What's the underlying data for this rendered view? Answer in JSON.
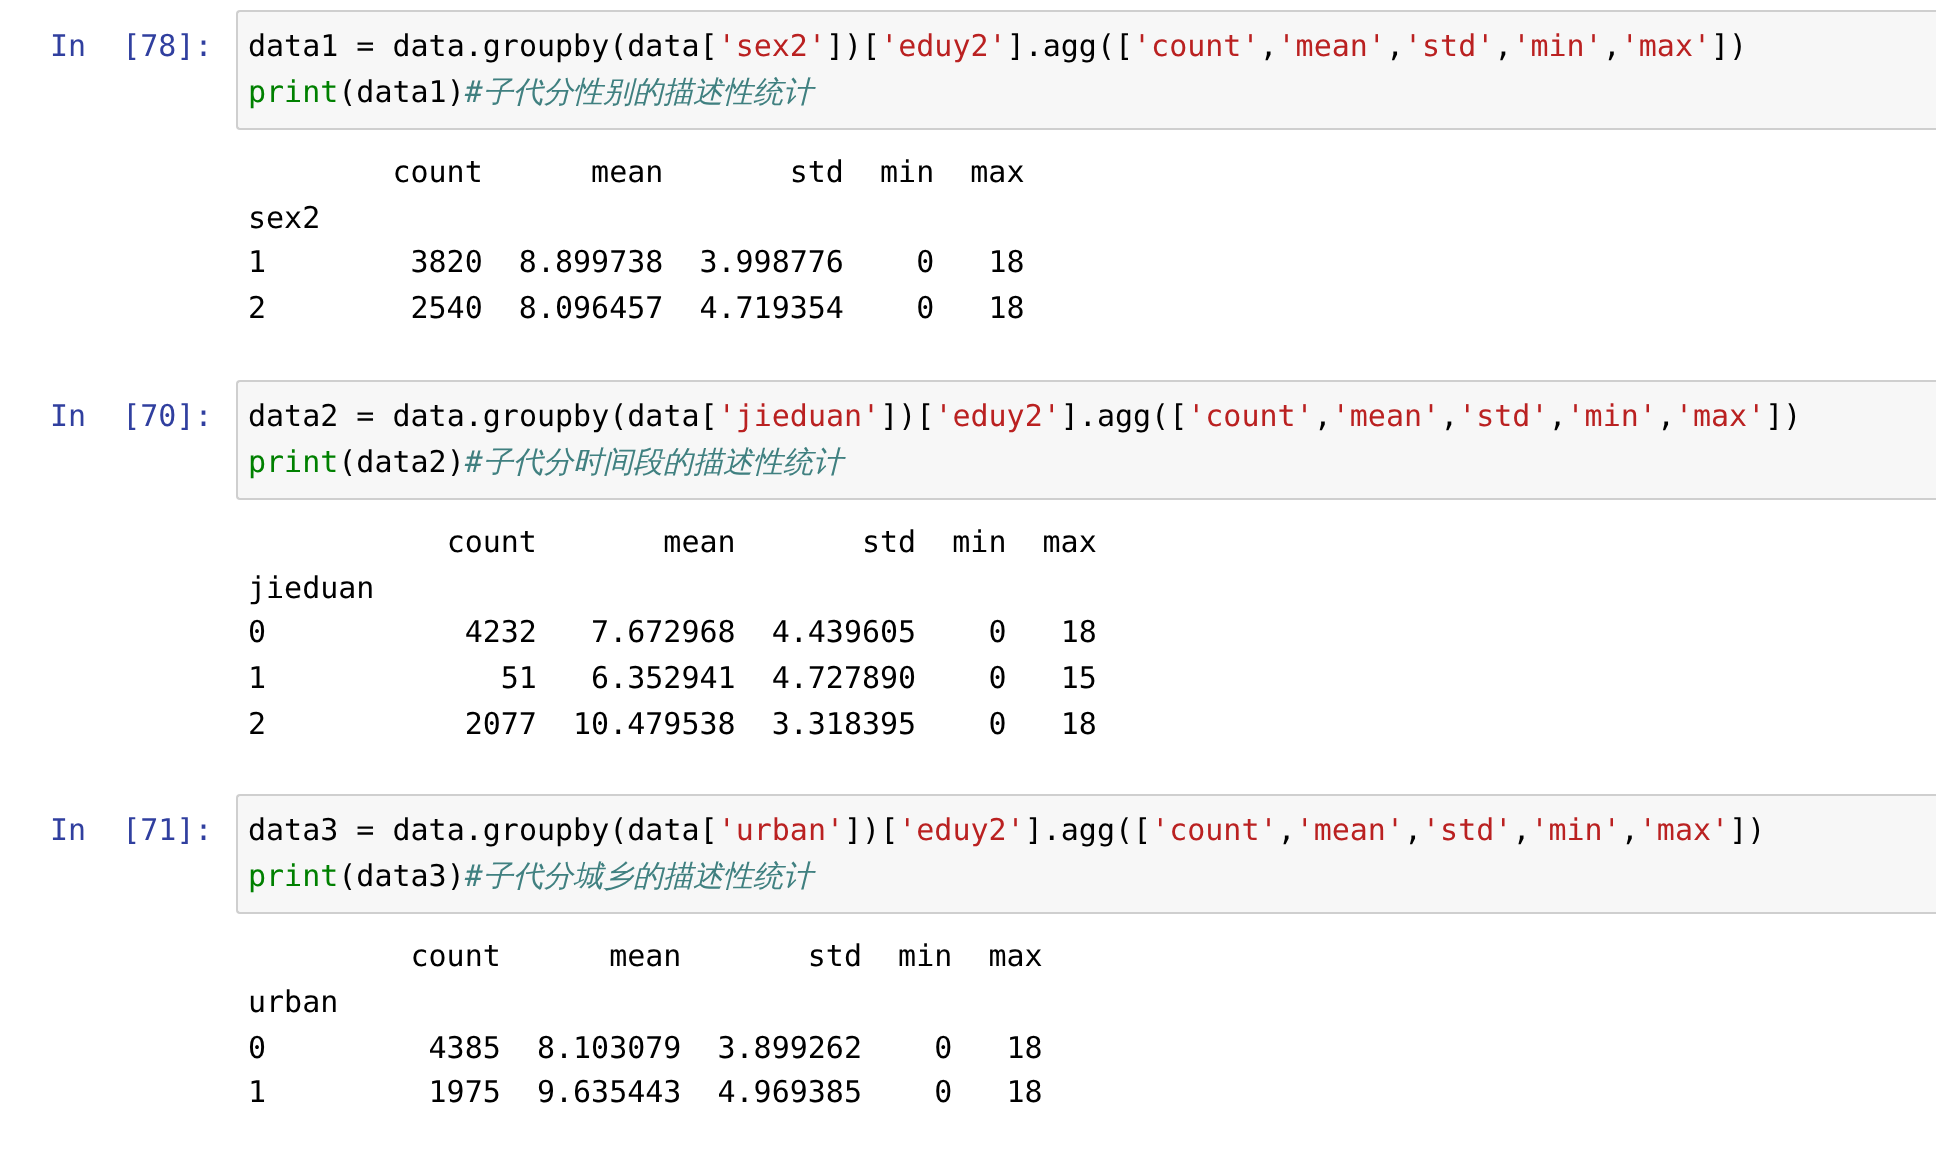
{
  "cells": [
    {
      "prompt": "In  [78]:",
      "code": [
        [
          {
            "kind": "plain",
            "text": "data1 = data.groupby(data["
          },
          {
            "kind": "string",
            "text": "'sex2'"
          },
          {
            "kind": "plain",
            "text": "])["
          },
          {
            "kind": "string",
            "text": "'eduy2'"
          },
          {
            "kind": "plain",
            "text": "].agg(["
          },
          {
            "kind": "string",
            "text": "'count'"
          },
          {
            "kind": "plain",
            "text": ","
          },
          {
            "kind": "string",
            "text": "'mean'"
          },
          {
            "kind": "plain",
            "text": ","
          },
          {
            "kind": "string",
            "text": "'std'"
          },
          {
            "kind": "plain",
            "text": ","
          },
          {
            "kind": "string",
            "text": "'min'"
          },
          {
            "kind": "plain",
            "text": ","
          },
          {
            "kind": "string",
            "text": "'max'"
          },
          {
            "kind": "plain",
            "text": "])"
          }
        ],
        [
          {
            "kind": "builtin",
            "text": "print"
          },
          {
            "kind": "plain",
            "text": "(data1)"
          },
          {
            "kind": "comment",
            "text": "#子代分性别的描述性统计"
          }
        ]
      ],
      "output": {
        "columns": [
          "count",
          "mean",
          "std",
          "min",
          "max"
        ],
        "index_name": "sex2",
        "rows": [
          {
            "index": "1",
            "values": [
              "3820",
              "8.899738",
              "3.998776",
              "0",
              "18"
            ]
          },
          {
            "index": "2",
            "values": [
              "2540",
              "8.096457",
              "4.719354",
              "0",
              "18"
            ]
          }
        ]
      }
    },
    {
      "prompt": "In  [70]:",
      "code": [
        [
          {
            "kind": "plain",
            "text": "data2 = data.groupby(data["
          },
          {
            "kind": "string",
            "text": "'jieduan'"
          },
          {
            "kind": "plain",
            "text": "])["
          },
          {
            "kind": "string",
            "text": "'eduy2'"
          },
          {
            "kind": "plain",
            "text": "].agg(["
          },
          {
            "kind": "string",
            "text": "'count'"
          },
          {
            "kind": "plain",
            "text": ","
          },
          {
            "kind": "string",
            "text": "'mean'"
          },
          {
            "kind": "plain",
            "text": ","
          },
          {
            "kind": "string",
            "text": "'std'"
          },
          {
            "kind": "plain",
            "text": ","
          },
          {
            "kind": "string",
            "text": "'min'"
          },
          {
            "kind": "plain",
            "text": ","
          },
          {
            "kind": "string",
            "text": "'max'"
          },
          {
            "kind": "plain",
            "text": "])"
          }
        ],
        [
          {
            "kind": "builtin",
            "text": "print"
          },
          {
            "kind": "plain",
            "text": "(data2)"
          },
          {
            "kind": "comment",
            "text": "#子代分时间段的描述性统计"
          }
        ]
      ],
      "output": {
        "columns": [
          "count",
          "mean",
          "std",
          "min",
          "max"
        ],
        "index_name": "jieduan",
        "rows": [
          {
            "index": "0",
            "values": [
              "4232",
              "7.672968",
              "4.439605",
              "0",
              "18"
            ]
          },
          {
            "index": "1",
            "values": [
              "51",
              "6.352941",
              "4.727890",
              "0",
              "15"
            ]
          },
          {
            "index": "2",
            "values": [
              "2077",
              "10.479538",
              "3.318395",
              "0",
              "18"
            ]
          }
        ]
      }
    },
    {
      "prompt": "In  [71]:",
      "code": [
        [
          {
            "kind": "plain",
            "text": "data3 = data.groupby(data["
          },
          {
            "kind": "string",
            "text": "'urban'"
          },
          {
            "kind": "plain",
            "text": "])["
          },
          {
            "kind": "string",
            "text": "'eduy2'"
          },
          {
            "kind": "plain",
            "text": "].agg(["
          },
          {
            "kind": "string",
            "text": "'count'"
          },
          {
            "kind": "plain",
            "text": ","
          },
          {
            "kind": "string",
            "text": "'mean'"
          },
          {
            "kind": "plain",
            "text": ","
          },
          {
            "kind": "string",
            "text": "'std'"
          },
          {
            "kind": "plain",
            "text": ","
          },
          {
            "kind": "string",
            "text": "'min'"
          },
          {
            "kind": "plain",
            "text": ","
          },
          {
            "kind": "string",
            "text": "'max'"
          },
          {
            "kind": "plain",
            "text": "])"
          }
        ],
        [
          {
            "kind": "builtin",
            "text": "print"
          },
          {
            "kind": "plain",
            "text": "(data3)"
          },
          {
            "kind": "comment",
            "text": "#子代分城乡的描述性统计"
          }
        ]
      ],
      "output": {
        "columns": [
          "count",
          "mean",
          "std",
          "min",
          "max"
        ],
        "index_name": "urban",
        "rows": [
          {
            "index": "0",
            "values": [
              "4385",
              "8.103079",
              "3.899262",
              "0",
              "18"
            ]
          },
          {
            "index": "1",
            "values": [
              "1975",
              "9.635443",
              "4.969385",
              "0",
              "18"
            ]
          }
        ]
      }
    }
  ]
}
